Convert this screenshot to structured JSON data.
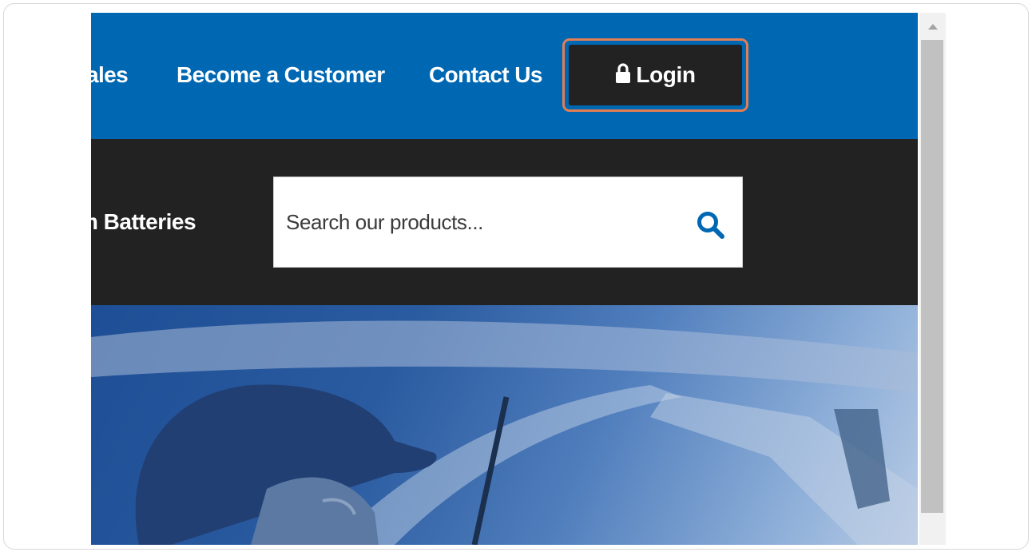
{
  "nav": {
    "partial_link": "ales",
    "become_customer": "Become a Customer",
    "contact_us": "Contact Us",
    "login": "Login"
  },
  "search": {
    "brand_partial": "m Batteries",
    "placeholder": "Search our products..."
  },
  "colors": {
    "nav_bg": "#0067b3",
    "band_bg": "#222222",
    "login_highlight": "#e27e52",
    "search_icon": "#0067b3"
  },
  "icons": {
    "login": "lock-icon",
    "search": "search-icon",
    "scroll": "chevron-up-icon"
  }
}
